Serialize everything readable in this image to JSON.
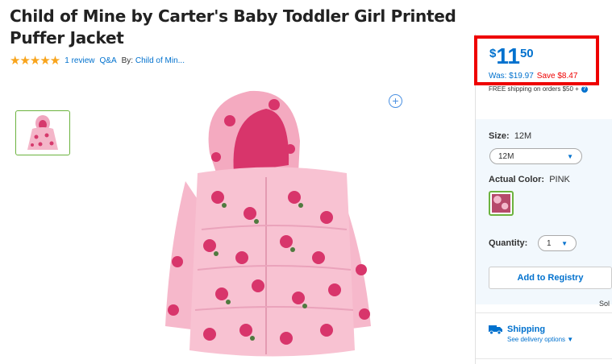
{
  "product": {
    "title": "Child of Mine by Carter's Baby Toddler Girl Printed Puffer Jacket",
    "rating_stars": "★★★★★",
    "reviews": "1 review",
    "qa": "Q&A",
    "by_label": "By:",
    "brand": "Child of Min..."
  },
  "price": {
    "currency": "$",
    "dollars": "11",
    "cents": "50",
    "was": "Was: $19.97",
    "save": "Save $8.47",
    "shipping_note": "FREE shipping on orders $50 +",
    "info_icon": "?"
  },
  "options": {
    "size_label": "Size:",
    "size_value": "12M",
    "size_select": "12M",
    "color_label": "Actual Color:",
    "color_value": "PINK",
    "quantity_label": "Quantity:",
    "quantity_value": "1",
    "registry_button": "Add to Registry",
    "sold_by_partial": "Sol"
  },
  "shipping": {
    "title": "Shipping",
    "link": "See delivery options"
  },
  "icons": {
    "zoom": "zoom-in-icon",
    "dropdown": "chevron-down-icon",
    "truck": "truck-icon",
    "info": "info-icon"
  },
  "colors": {
    "brand_blue": "#0071ce",
    "save_red": "#e00000",
    "star": "#f8a41c",
    "selected_green": "#6cb33f",
    "panel_bg": "#f2f8fd"
  }
}
